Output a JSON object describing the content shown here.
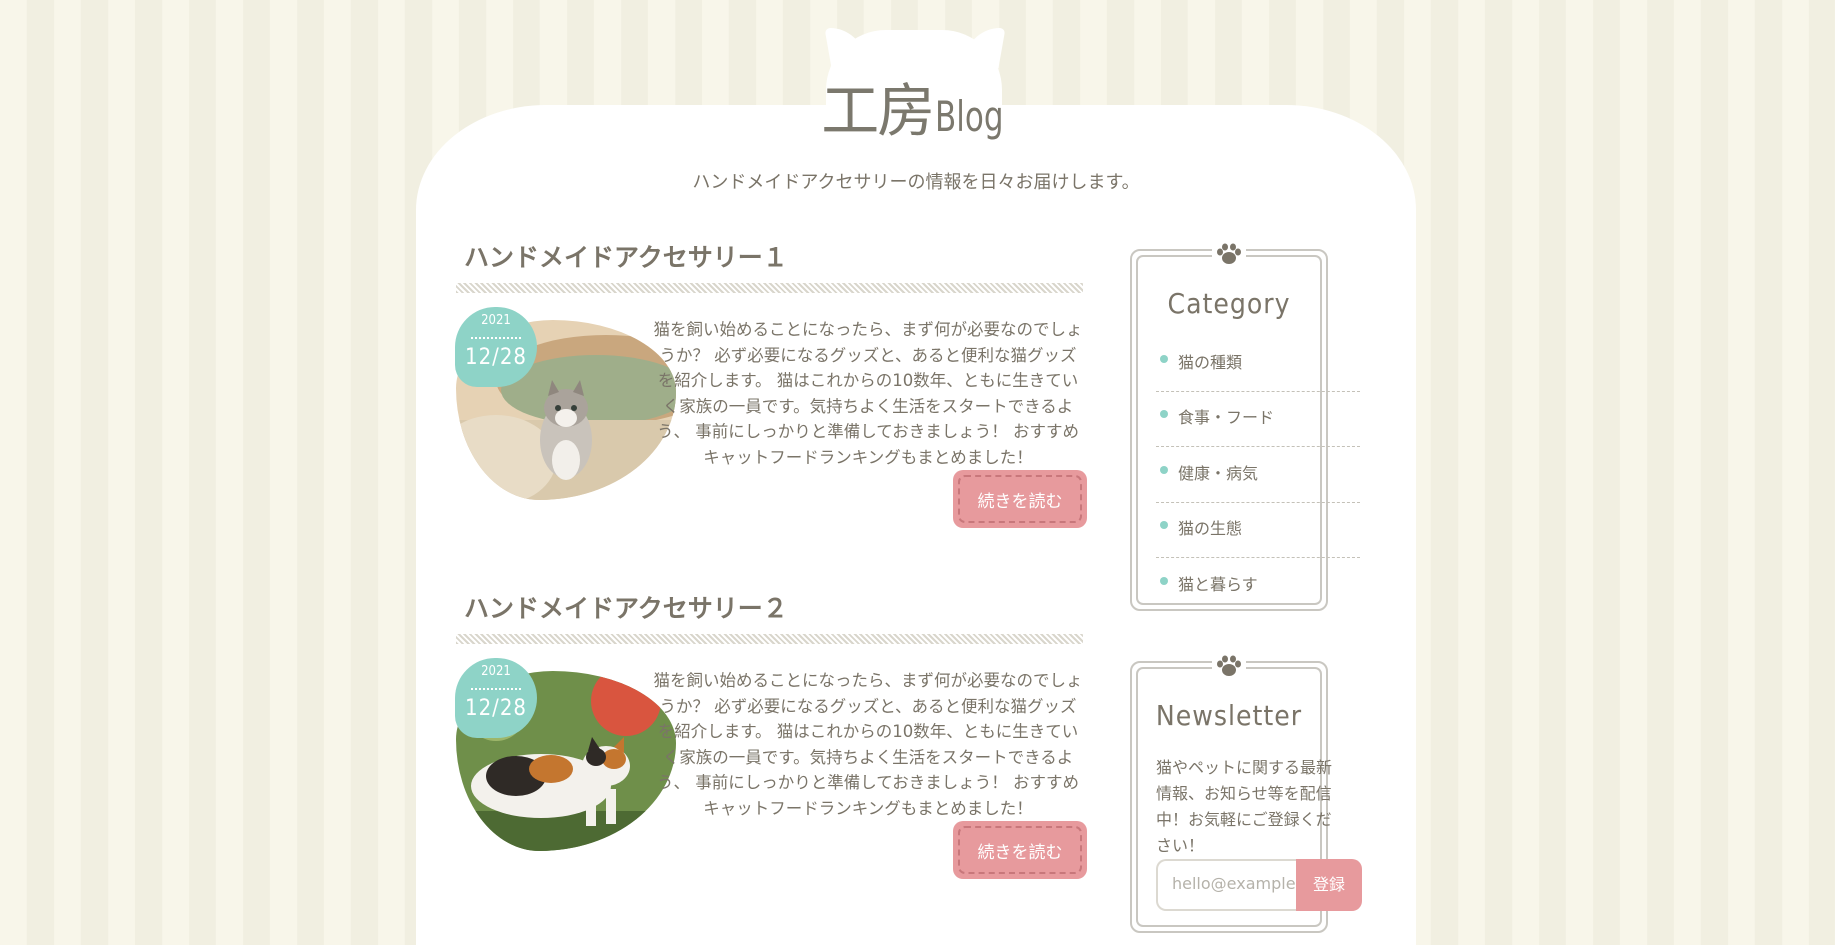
{
  "header": {
    "logo_jp": "工房",
    "logo_en": "Blog",
    "tagline": "ハンドメイドアクセサリーの情報を日々お届けします。"
  },
  "posts": [
    {
      "title": "ハンドメイドアクセサリー１",
      "year": "2021",
      "date": "12/28",
      "excerpt": "猫を飼い始めることになったら、まず何が必要なのでしょうか？ 必ず必要になるグッズと、あると便利な猫グッズを紹介します。 猫はこれからの10数年、ともに生きていく家族の一員です。気持ちよく生活をスタートできるよう、 事前にしっかりと準備しておきましょう！ おすすめキャットフードランキングもまとめました！",
      "read_more": "続きを読む"
    },
    {
      "title": "ハンドメイドアクセサリー２",
      "year": "2021",
      "date": "12/28",
      "excerpt": "猫を飼い始めることになったら、まず何が必要なのでしょうか？ 必ず必要になるグッズと、あると便利な猫グッズを紹介します。 猫はこれからの10数年、ともに生きていく家族の一員です。気持ちよく生活をスタートできるよう、 事前にしっかりと準備しておきましょう！ おすすめキャットフードランキングもまとめました！",
      "read_more": "続きを読む"
    }
  ],
  "sidebar": {
    "category": {
      "title": "Category",
      "items": [
        "猫の種類",
        "食事・フード",
        "健康・病気",
        "猫の生態",
        "猫と暮らす"
      ]
    },
    "newsletter": {
      "title": "Newsletter",
      "text": "猫やペットに関する最新情報、お知らせ等を配信中！お気軽にご登録ください！",
      "placeholder": "hello@example.com",
      "button": "登録"
    }
  },
  "colors": {
    "accent_teal": "#8ed3c7",
    "accent_pink": "#e79a9d",
    "text": "#7a7468"
  }
}
